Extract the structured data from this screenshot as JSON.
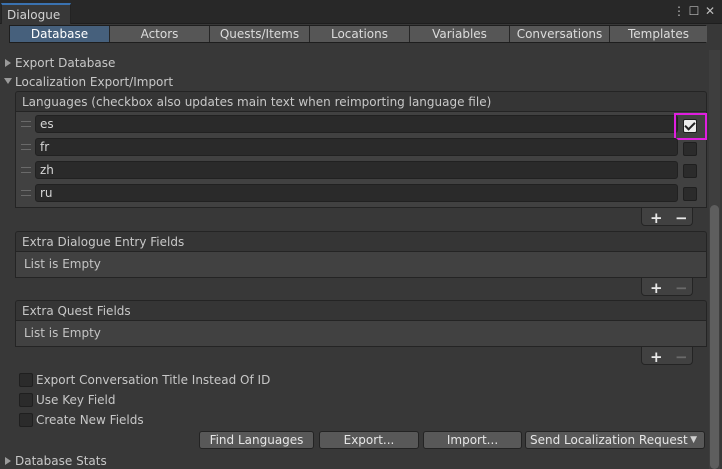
{
  "window": {
    "title": "Dialogue"
  },
  "tabs": [
    {
      "label": "Database"
    },
    {
      "label": "Actors"
    },
    {
      "label": "Quests/Items"
    },
    {
      "label": "Locations"
    },
    {
      "label": "Variables"
    },
    {
      "label": "Conversations"
    },
    {
      "label": "Templates"
    }
  ],
  "sections": {
    "export_database": "Export Database",
    "localization": "Localization Export/Import",
    "database_stats": "Database Stats"
  },
  "languages": {
    "header": "Languages (checkbox also updates main text when reimporting language file)",
    "items": [
      {
        "code": "es",
        "checked": true
      },
      {
        "code": "fr",
        "checked": false
      },
      {
        "code": "zh",
        "checked": false
      },
      {
        "code": "ru",
        "checked": false
      }
    ]
  },
  "extra_dialogue": {
    "header": "Extra Dialogue Entry Fields",
    "empty": "List is Empty"
  },
  "extra_quest": {
    "header": "Extra Quest Fields",
    "empty": "List is Empty"
  },
  "list_controls": {
    "add": "+",
    "remove": "−"
  },
  "options": [
    {
      "label": "Export Conversation Title Instead Of ID",
      "checked": false
    },
    {
      "label": "Use Key Field",
      "checked": false
    },
    {
      "label": "Create New Fields",
      "checked": false
    }
  ],
  "buttons": {
    "find_languages": "Find Languages",
    "export": "Export...",
    "import": "Import...",
    "send_request": "Send Localization Request"
  },
  "icons": {
    "menu": "⋮",
    "maximize": "☐",
    "close": "✕",
    "dropdown": "▼"
  },
  "colors": {
    "accent_tab": "#46607c",
    "highlight": "#e01ee0"
  }
}
